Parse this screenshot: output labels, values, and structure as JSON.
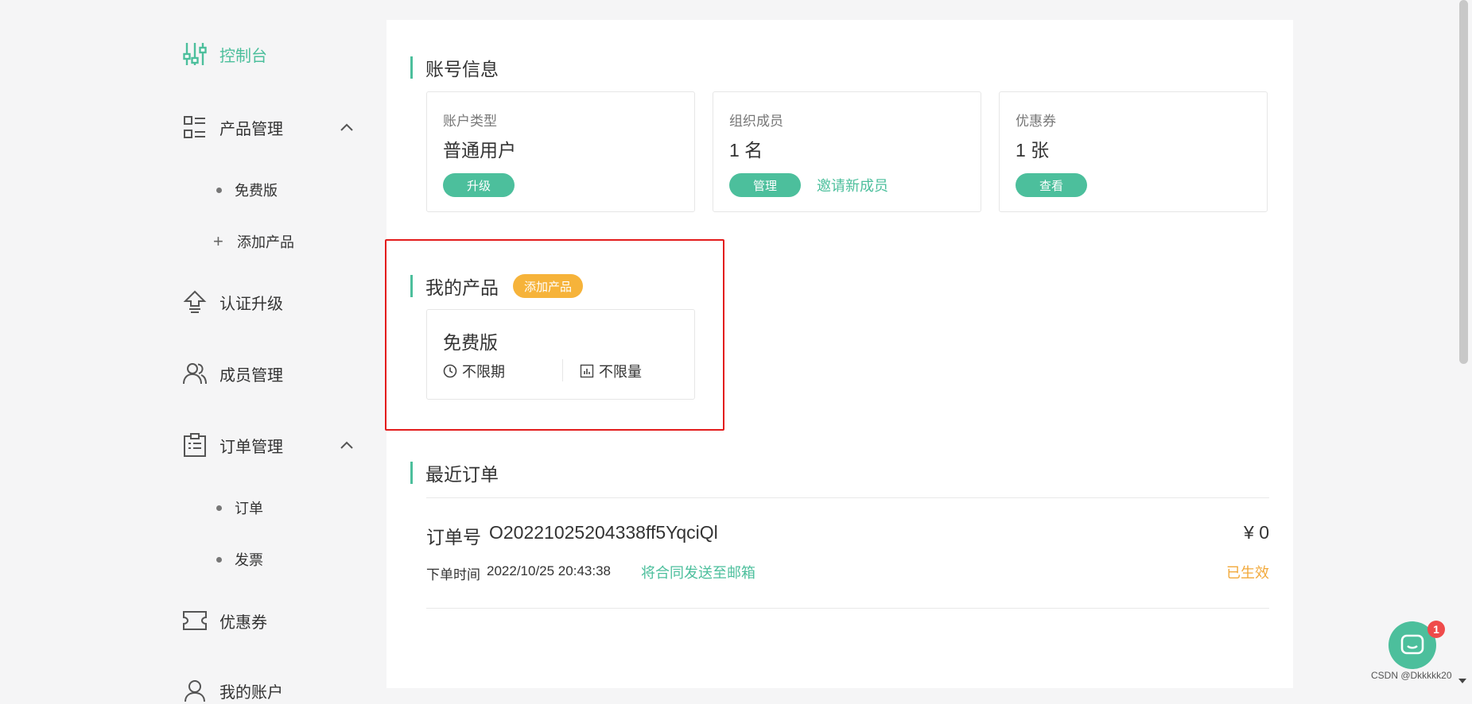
{
  "sidebar": {
    "dashboard": "控制台",
    "product_mgmt": "产品管理",
    "product_sub": {
      "free": "免费版",
      "add": "添加产品"
    },
    "cert_upgrade": "认证升级",
    "member_mgmt": "成员管理",
    "order_mgmt": "订单管理",
    "order_sub": {
      "orders": "订单",
      "invoice": "发票"
    },
    "coupons": "优惠券",
    "my_account": "我的账户"
  },
  "account_info": {
    "title": "账号信息",
    "type": {
      "label": "账户类型",
      "value": "普通用户",
      "button": "升级"
    },
    "members": {
      "label": "组织成员",
      "value": "1 名",
      "button": "管理",
      "link": "邀请新成员"
    },
    "coupon": {
      "label": "优惠券",
      "value": "1 张",
      "button": "查看"
    }
  },
  "products": {
    "title": "我的产品",
    "add_button": "添加产品",
    "card": {
      "name": "免费版",
      "feature_period": "不限期",
      "feature_quota": "不限量"
    }
  },
  "recent_orders": {
    "title": "最近订单",
    "order": {
      "no_label": "订单号",
      "no": "O20221025204338ff5YqciQl",
      "price": "¥ 0",
      "time_label": "下单时间",
      "time": "2022/10/25 20:43:38",
      "send_link": "将合同发送至邮箱",
      "status": "已生效"
    }
  },
  "chat": {
    "badge": "1"
  },
  "watermark": "CSDN @Dkkkkk20",
  "colors": {
    "accent": "#4cbf9c",
    "orange": "#f6b33a",
    "status": "#f2a93b",
    "highlight": "#e31c1c"
  }
}
